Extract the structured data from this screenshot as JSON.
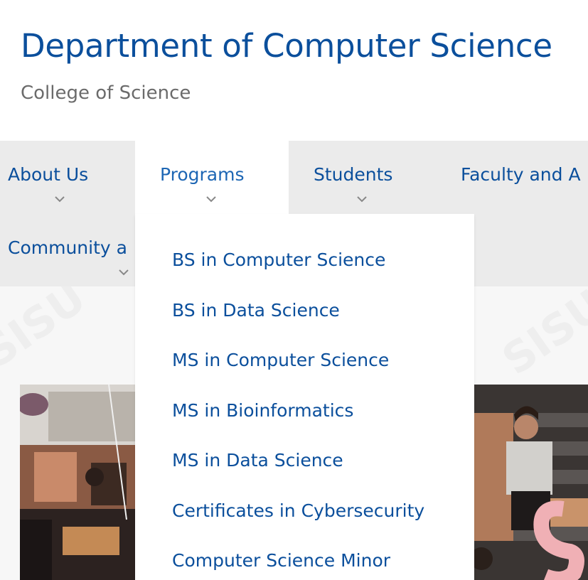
{
  "header": {
    "title": "Department of Computer Science",
    "subtitle": "College of Science"
  },
  "nav": {
    "items": [
      {
        "label": "About Us",
        "icon": "chevron-down-icon"
      },
      {
        "label": "Programs",
        "icon": "chevron-down-icon",
        "active": true
      },
      {
        "label": "Students",
        "icon": "chevron-down-icon"
      },
      {
        "label": "Faculty and A",
        "icon": null
      },
      {
        "label": "Community a",
        "icon": "chevron-down-icon"
      }
    ]
  },
  "dropdown": {
    "items": [
      {
        "label": "BS in Computer Science"
      },
      {
        "label": "BS in Data Science"
      },
      {
        "label": "MS in Computer Science"
      },
      {
        "label": "MS in Bioinformatics"
      },
      {
        "label": "MS in Data Science"
      },
      {
        "label": "Certificates in Cybersecurity"
      },
      {
        "label": "Computer Science Minor"
      }
    ]
  },
  "colors": {
    "link": "#0b4f9c",
    "nav_bg": "#ebebeb",
    "subtitle": "#6b6b6b"
  }
}
